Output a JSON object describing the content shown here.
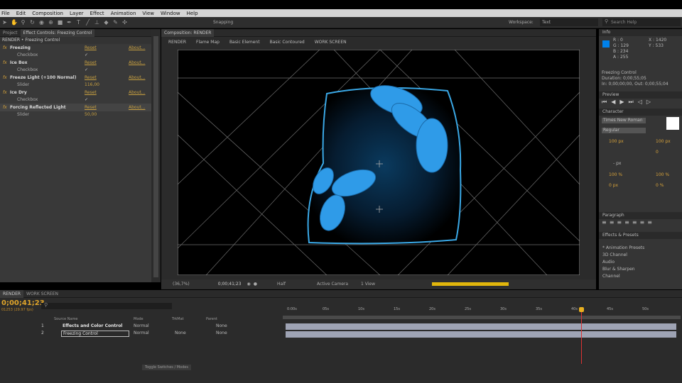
{
  "menu": [
    "File",
    "Edit",
    "Composition",
    "Layer",
    "Effect",
    "Animation",
    "View",
    "Window",
    "Help"
  ],
  "toolbar": {
    "snapping": "Snapping",
    "workspace_label": "Workspace:",
    "workspace_value": "Text",
    "search_placeholder": "Search Help"
  },
  "left_panel": {
    "tab_project": "Project",
    "tab_effects": "Effect Controls: Freezing Control",
    "header": "RENDER • Freezing Control"
  },
  "effects": [
    {
      "name": "Freezing",
      "reset": "Reset",
      "about": "About..."
    },
    {
      "sub": "Checkbox",
      "check": "✓"
    },
    {
      "name": "Ice Box",
      "reset": "Reset",
      "about": "About..."
    },
    {
      "sub": "Checkbox",
      "check": "✓"
    },
    {
      "name": "Freeze Light (+100 Normal)",
      "reset": "Reset",
      "about": "About..."
    },
    {
      "sub": "Slider",
      "value": "116,00"
    },
    {
      "name": "Ice Dry",
      "reset": "Reset",
      "about": "About..."
    },
    {
      "sub": "Checkbox",
      "check": "✓"
    },
    {
      "name": "Forcing Reflected Light",
      "reset": "Reset",
      "about": "About..."
    },
    {
      "sub": "Slider",
      "value": "50,00"
    }
  ],
  "comp": {
    "tab": "Composition: RENDER",
    "tabs": [
      "RENDER",
      "Flame Map",
      "Basic Element",
      "Basic Contoured",
      "WORK SCREEN"
    ],
    "zoom": "(36,7%)",
    "time": "0;00;41;23",
    "res": "Half",
    "camera": "Active Camera",
    "views": "1 View"
  },
  "info": {
    "title": "Info",
    "r": "R : 0",
    "g": "G : 129",
    "b": "B : 234",
    "a": "A : 255",
    "x": "X : 1420",
    "y": "Y : 533",
    "layer": "Freezing Control",
    "duration": "Duration: 0;00;55;05",
    "inout": "In: 0;00;00;00, Out: 0;00;55;04"
  },
  "preview": {
    "title": "Preview"
  },
  "character": {
    "title": "Character",
    "font": "Times New Roman",
    "style": "Regular",
    "size": "100 px",
    "leading": "100 px",
    "tracking": "0",
    "v_scale": "100 %",
    "h_scale": "100 %",
    "baseline": "0 px",
    "tsume": "0 %",
    "indent": "- px"
  },
  "paragraph": {
    "title": "Paragraph"
  },
  "fxpresets": {
    "title": "Effects & Presets",
    "items": [
      "* Animation Presets",
      "3D Channel",
      "Audio",
      "Blur & Sharpen",
      "Channel"
    ]
  },
  "timeline": {
    "tabs": [
      "RENDER",
      "WORK SCREEN"
    ],
    "timecode": "0;00;41;23",
    "fps": "01253 (29.97 fps)",
    "col_source": "Source Name",
    "col_mode": "Mode",
    "col_trkmat": "TrkMat",
    "col_parent": "Parent",
    "layers": [
      {
        "num": "1",
        "name": "Effects and Color Control",
        "mode": "Normal",
        "trk": "",
        "parent": "None"
      },
      {
        "num": "2",
        "name": "Freezing Control",
        "mode": "Normal",
        "trk": "None",
        "parent": "None"
      }
    ],
    "ruler": [
      "0:00s",
      "05s",
      "10s",
      "15s",
      "20s",
      "25s",
      "30s",
      "35s",
      "40s",
      "45s",
      "50s"
    ],
    "toggle": "Toggle Switches / Modes"
  }
}
